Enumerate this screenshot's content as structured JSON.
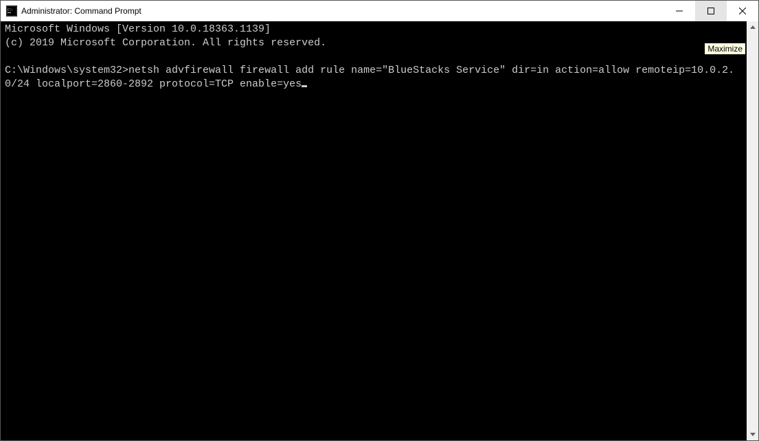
{
  "window": {
    "title": "Administrator: Command Prompt",
    "tooltip": "Maximize"
  },
  "terminal": {
    "header_line1": "Microsoft Windows [Version 10.0.18363.1139]",
    "header_line2": "(c) 2019 Microsoft Corporation. All rights reserved.",
    "blank": "",
    "prompt_path": "C:\\Windows\\system32>",
    "command": "netsh advfirewall firewall add rule name=\"BlueStacks Service\" dir=in action=allow remoteip=10.0.2.0/24 localport=2860-2892 protocol=TCP enable=yes"
  }
}
